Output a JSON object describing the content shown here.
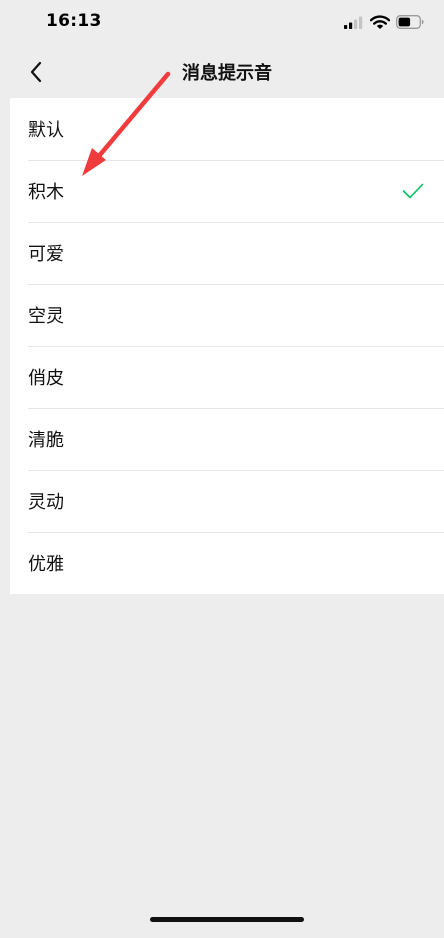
{
  "status_bar": {
    "time": "16:13",
    "icons": [
      "signal-icon",
      "wifi-icon",
      "battery-icon"
    ]
  },
  "nav": {
    "back_icon": "chevron-left-icon",
    "title": "消息提示音"
  },
  "sounds": {
    "items": [
      {
        "label": "默认",
        "selected": false
      },
      {
        "label": "积木",
        "selected": true
      },
      {
        "label": "可爱",
        "selected": false
      },
      {
        "label": "空灵",
        "selected": false
      },
      {
        "label": "俏皮",
        "selected": false
      },
      {
        "label": "清脆",
        "selected": false
      },
      {
        "label": "灵动",
        "selected": false
      },
      {
        "label": "优雅",
        "selected": false
      }
    ]
  },
  "colors": {
    "background": "#ededed",
    "list_background": "#ffffff",
    "check": "#07c160",
    "annotation": "#f03c3c"
  }
}
